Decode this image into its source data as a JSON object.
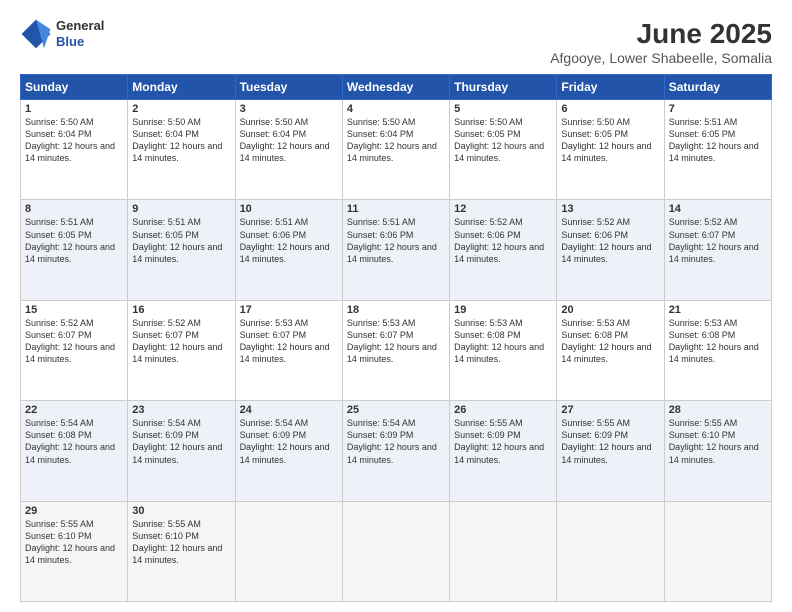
{
  "logo": {
    "general": "General",
    "blue": "Blue"
  },
  "title": "June 2025",
  "subtitle": "Afgooye, Lower Shabeelle, Somalia",
  "days_of_week": [
    "Sunday",
    "Monday",
    "Tuesday",
    "Wednesday",
    "Thursday",
    "Friday",
    "Saturday"
  ],
  "weeks": [
    [
      {
        "day": "1",
        "sunrise": "Sunrise: 5:50 AM",
        "sunset": "Sunset: 6:04 PM",
        "daylight": "Daylight: 12 hours and 14 minutes."
      },
      {
        "day": "2",
        "sunrise": "Sunrise: 5:50 AM",
        "sunset": "Sunset: 6:04 PM",
        "daylight": "Daylight: 12 hours and 14 minutes."
      },
      {
        "day": "3",
        "sunrise": "Sunrise: 5:50 AM",
        "sunset": "Sunset: 6:04 PM",
        "daylight": "Daylight: 12 hours and 14 minutes."
      },
      {
        "day": "4",
        "sunrise": "Sunrise: 5:50 AM",
        "sunset": "Sunset: 6:04 PM",
        "daylight": "Daylight: 12 hours and 14 minutes."
      },
      {
        "day": "5",
        "sunrise": "Sunrise: 5:50 AM",
        "sunset": "Sunset: 6:05 PM",
        "daylight": "Daylight: 12 hours and 14 minutes."
      },
      {
        "day": "6",
        "sunrise": "Sunrise: 5:50 AM",
        "sunset": "Sunset: 6:05 PM",
        "daylight": "Daylight: 12 hours and 14 minutes."
      },
      {
        "day": "7",
        "sunrise": "Sunrise: 5:51 AM",
        "sunset": "Sunset: 6:05 PM",
        "daylight": "Daylight: 12 hours and 14 minutes."
      }
    ],
    [
      {
        "day": "8",
        "sunrise": "Sunrise: 5:51 AM",
        "sunset": "Sunset: 6:05 PM",
        "daylight": "Daylight: 12 hours and 14 minutes."
      },
      {
        "day": "9",
        "sunrise": "Sunrise: 5:51 AM",
        "sunset": "Sunset: 6:05 PM",
        "daylight": "Daylight: 12 hours and 14 minutes."
      },
      {
        "day": "10",
        "sunrise": "Sunrise: 5:51 AM",
        "sunset": "Sunset: 6:06 PM",
        "daylight": "Daylight: 12 hours and 14 minutes."
      },
      {
        "day": "11",
        "sunrise": "Sunrise: 5:51 AM",
        "sunset": "Sunset: 6:06 PM",
        "daylight": "Daylight: 12 hours and 14 minutes."
      },
      {
        "day": "12",
        "sunrise": "Sunrise: 5:52 AM",
        "sunset": "Sunset: 6:06 PM",
        "daylight": "Daylight: 12 hours and 14 minutes."
      },
      {
        "day": "13",
        "sunrise": "Sunrise: 5:52 AM",
        "sunset": "Sunset: 6:06 PM",
        "daylight": "Daylight: 12 hours and 14 minutes."
      },
      {
        "day": "14",
        "sunrise": "Sunrise: 5:52 AM",
        "sunset": "Sunset: 6:07 PM",
        "daylight": "Daylight: 12 hours and 14 minutes."
      }
    ],
    [
      {
        "day": "15",
        "sunrise": "Sunrise: 5:52 AM",
        "sunset": "Sunset: 6:07 PM",
        "daylight": "Daylight: 12 hours and 14 minutes."
      },
      {
        "day": "16",
        "sunrise": "Sunrise: 5:52 AM",
        "sunset": "Sunset: 6:07 PM",
        "daylight": "Daylight: 12 hours and 14 minutes."
      },
      {
        "day": "17",
        "sunrise": "Sunrise: 5:53 AM",
        "sunset": "Sunset: 6:07 PM",
        "daylight": "Daylight: 12 hours and 14 minutes."
      },
      {
        "day": "18",
        "sunrise": "Sunrise: 5:53 AM",
        "sunset": "Sunset: 6:07 PM",
        "daylight": "Daylight: 12 hours and 14 minutes."
      },
      {
        "day": "19",
        "sunrise": "Sunrise: 5:53 AM",
        "sunset": "Sunset: 6:08 PM",
        "daylight": "Daylight: 12 hours and 14 minutes."
      },
      {
        "day": "20",
        "sunrise": "Sunrise: 5:53 AM",
        "sunset": "Sunset: 6:08 PM",
        "daylight": "Daylight: 12 hours and 14 minutes."
      },
      {
        "day": "21",
        "sunrise": "Sunrise: 5:53 AM",
        "sunset": "Sunset: 6:08 PM",
        "daylight": "Daylight: 12 hours and 14 minutes."
      }
    ],
    [
      {
        "day": "22",
        "sunrise": "Sunrise: 5:54 AM",
        "sunset": "Sunset: 6:08 PM",
        "daylight": "Daylight: 12 hours and 14 minutes."
      },
      {
        "day": "23",
        "sunrise": "Sunrise: 5:54 AM",
        "sunset": "Sunset: 6:09 PM",
        "daylight": "Daylight: 12 hours and 14 minutes."
      },
      {
        "day": "24",
        "sunrise": "Sunrise: 5:54 AM",
        "sunset": "Sunset: 6:09 PM",
        "daylight": "Daylight: 12 hours and 14 minutes."
      },
      {
        "day": "25",
        "sunrise": "Sunrise: 5:54 AM",
        "sunset": "Sunset: 6:09 PM",
        "daylight": "Daylight: 12 hours and 14 minutes."
      },
      {
        "day": "26",
        "sunrise": "Sunrise: 5:55 AM",
        "sunset": "Sunset: 6:09 PM",
        "daylight": "Daylight: 12 hours and 14 minutes."
      },
      {
        "day": "27",
        "sunrise": "Sunrise: 5:55 AM",
        "sunset": "Sunset: 6:09 PM",
        "daylight": "Daylight: 12 hours and 14 minutes."
      },
      {
        "day": "28",
        "sunrise": "Sunrise: 5:55 AM",
        "sunset": "Sunset: 6:10 PM",
        "daylight": "Daylight: 12 hours and 14 minutes."
      }
    ],
    [
      {
        "day": "29",
        "sunrise": "Sunrise: 5:55 AM",
        "sunset": "Sunset: 6:10 PM",
        "daylight": "Daylight: 12 hours and 14 minutes."
      },
      {
        "day": "30",
        "sunrise": "Sunrise: 5:55 AM",
        "sunset": "Sunset: 6:10 PM",
        "daylight": "Daylight: 12 hours and 14 minutes."
      },
      null,
      null,
      null,
      null,
      null
    ]
  ]
}
